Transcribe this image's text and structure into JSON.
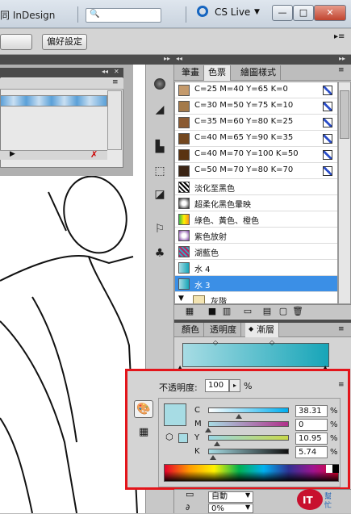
{
  "window": {
    "title": "同 InDesign",
    "cs_live": "CS Live",
    "controls": [
      "—",
      "□",
      "✕"
    ]
  },
  "control_bar": {
    "preferences_button": "偏好設定"
  },
  "swatches_panel": {
    "tabs": [
      "筆畫",
      "色票",
      "繪圖樣式"
    ],
    "active_tab": "色票",
    "items": [
      {
        "label": "C=25 M=40 Y=65 K=0",
        "color": "#c49a6c"
      },
      {
        "label": "C=30 M=50 Y=75 K=10",
        "color": "#a47a4a"
      },
      {
        "label": "C=35 M=60 Y=80 K=25",
        "color": "#8a5a32"
      },
      {
        "label": "C=40 M=65 Y=90 K=35",
        "color": "#72471f"
      },
      {
        "label": "C=40 M=70 Y=100 K=50",
        "color": "#5a3311"
      },
      {
        "label": "C=50 M=70 Y=80 K=70",
        "color": "#3b2414"
      },
      {
        "label": "淡化至黑色",
        "color": "#777777"
      },
      {
        "label": "超柔化黑色暈映",
        "color": "#333333"
      },
      {
        "label": "綠色、黃色、橙色",
        "color": "#e8a400"
      },
      {
        "label": "紫色放射",
        "color": "#7a3aa0"
      },
      {
        "label": "湖藍色",
        "color": "#3aa6c0"
      },
      {
        "label": "水 4",
        "color": "#17a5b8"
      },
      {
        "label": "水 3",
        "color": "#a7dce4"
      }
    ],
    "selected": "水 3",
    "group_label": "灰階"
  },
  "gradient_panel": {
    "tabs": [
      "顏色",
      "透明度",
      "漸層"
    ],
    "active_tab": "漸層",
    "gradient_start": "#a7dce4",
    "gradient_end": "#17a5b8"
  },
  "color_panel": {
    "opacity_label": "不透明度:",
    "opacity_value": "100",
    "opacity_unit": "%",
    "fill_color": "#a7dce4",
    "channels": [
      {
        "name": "C",
        "value": "38.31",
        "unit": "%",
        "ratio": 0.3831
      },
      {
        "name": "M",
        "value": "0",
        "unit": "%",
        "ratio": 0.0
      },
      {
        "name": "Y",
        "value": "10.95",
        "unit": "%",
        "ratio": 0.1095
      },
      {
        "name": "K",
        "value": "5.74",
        "unit": "%",
        "ratio": 0.0574
      }
    ],
    "highlight_color": "#e3151b"
  },
  "bottom": {
    "auto_select": "自動",
    "percent_select": "0%"
  },
  "watermark": {
    "text": "IT 幫忙"
  }
}
